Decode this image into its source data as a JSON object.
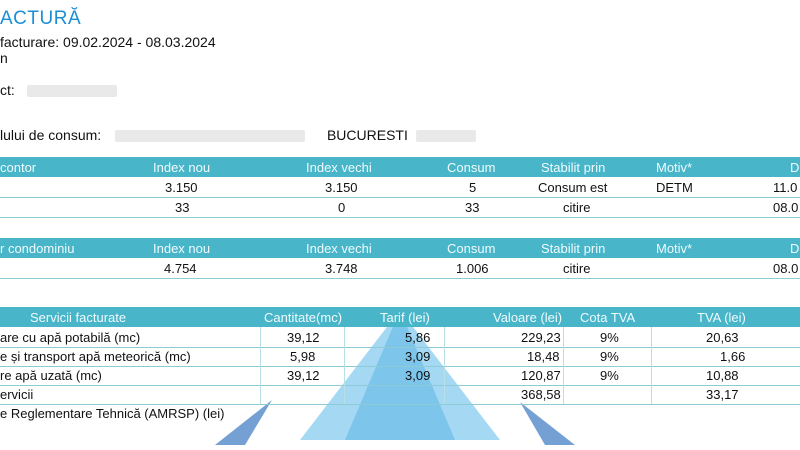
{
  "header": {
    "title": "ACTURĂ",
    "period_label": "facturare: 09.02.2024 - 08.03.2024",
    "line2": "n",
    "line3": "ct:",
    "consum_label": "lului de consum:",
    "city": "BUCURESTI"
  },
  "table1": {
    "headers": [
      "contor",
      "Index nou",
      "Index vechi",
      "Consum",
      "Stabilit prin",
      "Motiv*",
      "D"
    ],
    "rows": [
      [
        "",
        "3.150",
        "3.150",
        "5",
        "Consum est",
        "DETM",
        "11.0"
      ],
      [
        "",
        "33",
        "0",
        "33",
        "citire",
        "",
        "08.0"
      ]
    ]
  },
  "table2": {
    "headers": [
      "r condominiu",
      "Index nou",
      "Index vechi",
      "Consum",
      "Stabilit prin",
      "Motiv*",
      "D"
    ],
    "rows": [
      [
        "",
        "4.754",
        "3.748",
        "1.006",
        "citire",
        "",
        "08.0"
      ]
    ]
  },
  "table3": {
    "headers": [
      "Servicii facturate",
      "Cantitate(mc)",
      "Tarif (lei)",
      "Valoare (lei)",
      "Cota TVA",
      "TVA (lei)"
    ],
    "rows": [
      [
        "are cu apă potabilă (mc)",
        "39,12",
        "5,86",
        "229,23",
        "9%",
        "20,63"
      ],
      [
        "e și transport apă meteorică (mc)",
        "5,98",
        "3,09",
        "18,48",
        "9%",
        "1,66"
      ],
      [
        "re apă uzată (mc)",
        "39,12",
        "3,09",
        "120,87",
        "9%",
        "10,88"
      ],
      [
        "ervicii",
        "",
        "",
        "368,58",
        "",
        "33,17"
      ]
    ],
    "footer": "e Reglementare Tehnică (AMRSP) (lei)"
  },
  "colors": {
    "header_bg": "#48b6c8",
    "title": "#1a8fd6",
    "grid": "#8ccad6",
    "watermark": "#5fb4e6"
  }
}
